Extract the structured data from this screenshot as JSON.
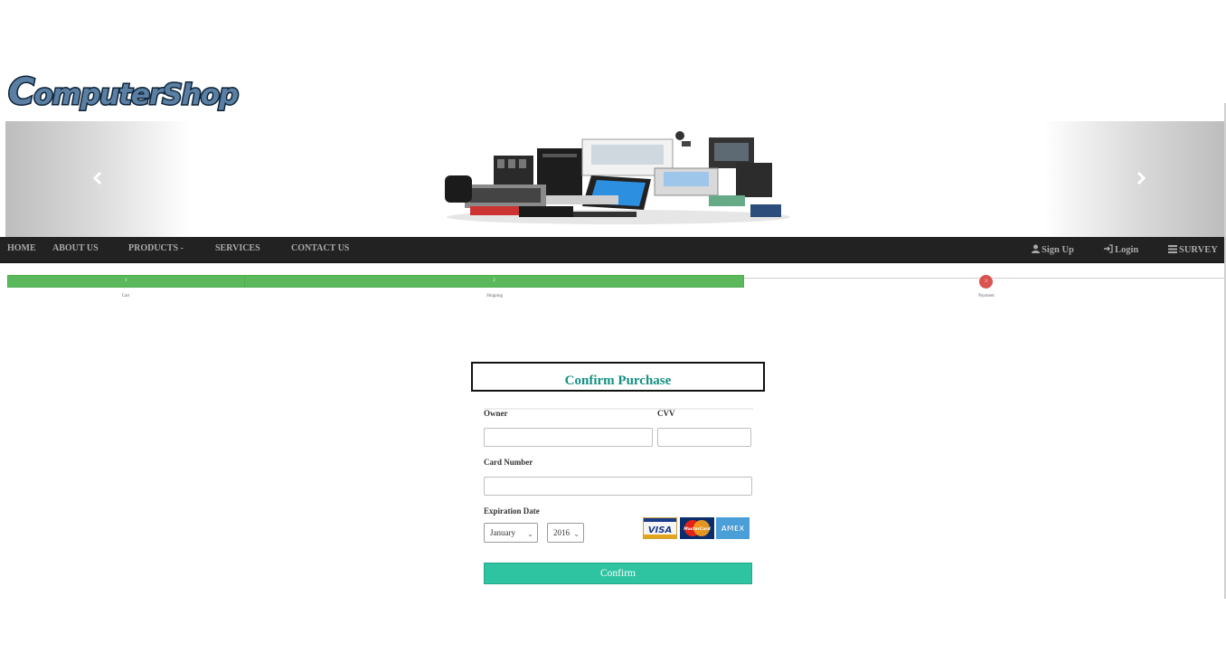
{
  "brand": {
    "logo_text_prefix": "C",
    "logo_text_rest": "omputerShop"
  },
  "carousel": {
    "prev_icon": "chevron-left-icon",
    "next_icon": "chevron-right-icon"
  },
  "nav": {
    "items": [
      {
        "label": "HOME"
      },
      {
        "label": "ABOUT US"
      },
      {
        "label": "PRODUCTS -"
      },
      {
        "label": "SERVICES"
      },
      {
        "label": "CONTACT US"
      }
    ],
    "signup": "Sign Up",
    "login": "Login",
    "survey": "SURVEY",
    "background": "#222222",
    "text_color": "#a9a9a9"
  },
  "progress": {
    "steps": [
      {
        "number": "1",
        "label": "Cart",
        "status": "complete"
      },
      {
        "number": "2",
        "label": "Shipping",
        "status": "complete"
      },
      {
        "number": "3",
        "label": "Payment",
        "status": "current"
      }
    ],
    "complete_color": "#5cb85c",
    "current_color": "#d9534f"
  },
  "form": {
    "title": "Confirm Purchase",
    "title_color": "#148f82",
    "owner_label": "Owner",
    "owner_value": "",
    "cvv_label": "CVV",
    "cvv_value": "",
    "card_number_label": "Card Number",
    "card_number_value": "",
    "expiration_label": "Expiration Date",
    "month_selected": "January",
    "year_selected": "2016",
    "cards": [
      "VISA",
      "MasterCard",
      "AMEX"
    ],
    "confirm_label": "Confirm",
    "confirm_color": "#2ec4a1"
  }
}
